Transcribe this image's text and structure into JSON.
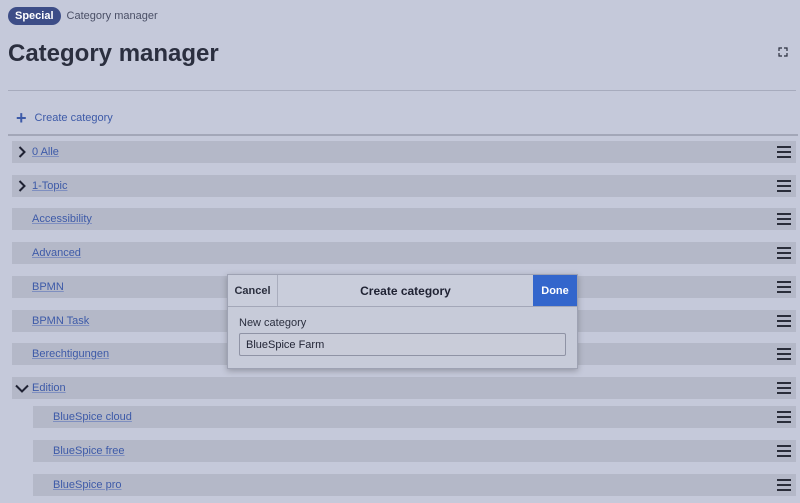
{
  "breadcrumb": {
    "badge": "Special",
    "page": "Category manager"
  },
  "page": {
    "title": "Category manager"
  },
  "toolbar": {
    "create_label": "Create category"
  },
  "tree": [
    {
      "label": "0 Alle",
      "expander": "collapsed"
    },
    {
      "label": "1-Topic",
      "expander": "collapsed"
    },
    {
      "label": "Accessibility",
      "expander": "none"
    },
    {
      "label": "Advanced",
      "expander": "none"
    },
    {
      "label": "BPMN",
      "expander": "none"
    },
    {
      "label": "BPMN Task",
      "expander": "none"
    },
    {
      "label": "Berechtigungen",
      "expander": "none"
    },
    {
      "label": "Edition",
      "expander": "expanded"
    },
    {
      "label": "BlueSpice cloud",
      "expander": "none",
      "child": true
    },
    {
      "label": "BlueSpice free",
      "expander": "none",
      "child": true
    },
    {
      "label": "BlueSpice pro",
      "expander": "none",
      "child": true
    }
  ],
  "dialog": {
    "cancel_label": "Cancel",
    "title": "Create category",
    "done_label": "Done",
    "field_label": "New category",
    "field_value": "BlueSpice Farm"
  },
  "colors": {
    "accent": "#3366cc",
    "link": "#3d5aa8",
    "badge": "#3d4d87"
  }
}
